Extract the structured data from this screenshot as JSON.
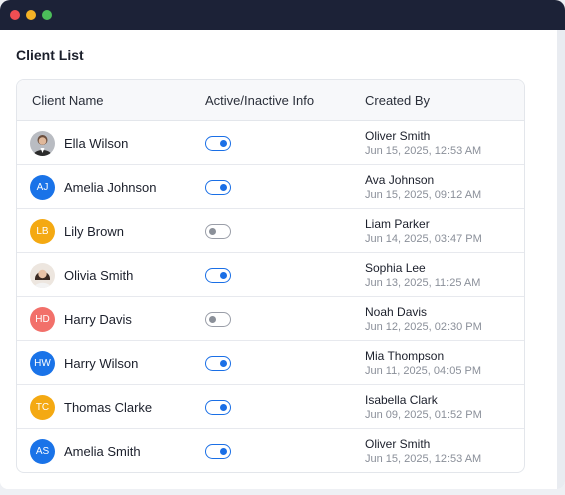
{
  "window": {
    "controls": [
      "close",
      "minimize",
      "maximize"
    ]
  },
  "page": {
    "title": "Client List"
  },
  "table": {
    "headers": {
      "name": "Client Name",
      "active": "Active/Inactive Info",
      "created": "Created By"
    },
    "rows": [
      {
        "initials": "",
        "avatar_type": "photo-man",
        "avatar_color": "#8a8f99",
        "name": "Ella Wilson",
        "active": true,
        "creator": "Oliver Smith",
        "date": "Jun 15, 2025, 12:53 AM"
      },
      {
        "initials": "AJ",
        "avatar_type": "initials",
        "avatar_color": "#1a73e8",
        "name": "Amelia Johnson",
        "active": true,
        "creator": "Ava Johnson",
        "date": "Jun 15, 2025, 09:12 AM"
      },
      {
        "initials": "LB",
        "avatar_type": "initials",
        "avatar_color": "#f4a912",
        "name": "Lily Brown",
        "active": false,
        "creator": "Liam Parker",
        "date": "Jun 14, 2025, 03:47 PM"
      },
      {
        "initials": "",
        "avatar_type": "photo-woman",
        "avatar_color": "#c9a58b",
        "name": "Olivia Smith",
        "active": true,
        "creator": "Sophia Lee",
        "date": "Jun 13, 2025, 11:25 AM"
      },
      {
        "initials": "HD",
        "avatar_type": "initials",
        "avatar_color": "#f2706a",
        "name": "Harry Davis",
        "active": false,
        "creator": "Noah Davis",
        "date": "Jun 12, 2025, 02:30 PM"
      },
      {
        "initials": "HW",
        "avatar_type": "initials",
        "avatar_color": "#1a73e8",
        "name": "Harry Wilson",
        "active": true,
        "creator": "Mia Thompson",
        "date": "Jun 11, 2025, 04:05 PM"
      },
      {
        "initials": "TC",
        "avatar_type": "initials",
        "avatar_color": "#f4a912",
        "name": "Thomas Clarke",
        "active": true,
        "creator": "Isabella Clark",
        "date": "Jun 09, 2025, 01:52 PM"
      },
      {
        "initials": "AS",
        "avatar_type": "initials",
        "avatar_color": "#1a73e8",
        "name": "Amelia Smith",
        "active": true,
        "creator": "Oliver Smith",
        "date": "Jun 15, 2025, 12:53 AM"
      }
    ]
  },
  "colors": {
    "titlebar": "#1c2237",
    "accent": "#1a6fe6",
    "toggle_off": "#8b9099"
  }
}
